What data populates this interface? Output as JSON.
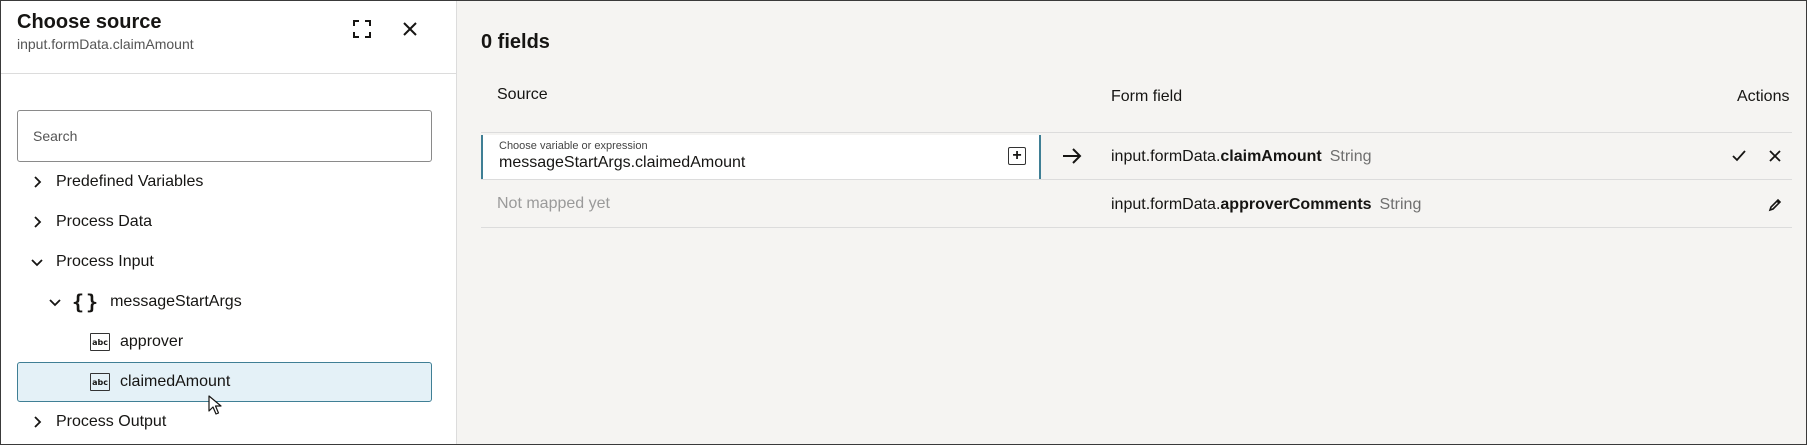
{
  "left_panel": {
    "title": "Choose source",
    "subtitle": "input.formData.claimAmount",
    "expand_icon": "expand-icon",
    "close_icon": "close-icon",
    "search": {
      "placeholder": "Search",
      "value": ""
    },
    "tree": {
      "predefined_variables": "Predefined Variables",
      "process_data": "Process Data",
      "process_input": "Process Input",
      "message_start_args": "messageStartArgs",
      "approver": "approver",
      "claimed_amount": "claimedAmount",
      "process_output": "Process Output"
    }
  },
  "right_panel": {
    "title": "0 fields",
    "columns": {
      "source": "Source",
      "form_field": "Form field",
      "actions": "Actions"
    },
    "rows": [
      {
        "source_label": "Choose variable or expression",
        "source_value": "messageStartArgs.claimedAmount",
        "field_prefix": "input.formData.",
        "field_name": "claimAmount",
        "field_type": "String"
      },
      {
        "source_value": "Not mapped yet",
        "field_prefix": "input.formData.",
        "field_name": "approverComments",
        "field_type": "String"
      }
    ]
  },
  "colors": {
    "accent": "#3f7f95",
    "selected_bg": "#e4f1f7",
    "right_bg": "#f5f4f2",
    "muted_text": "#9a9a9a"
  }
}
